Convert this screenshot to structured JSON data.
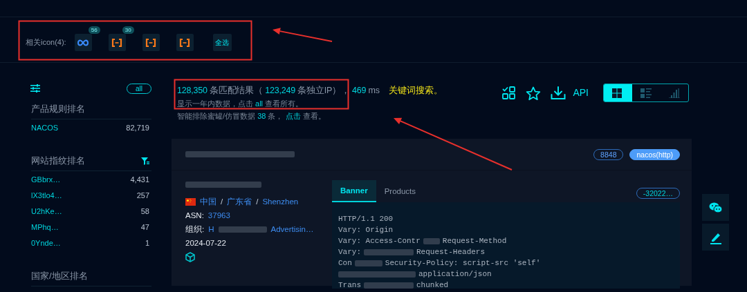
{
  "icon_filter": {
    "label": "相关icon(4):",
    "icons": [
      {
        "kind": "infinity",
        "badge": "56"
      },
      {
        "kind": "bracket",
        "badge": "30"
      },
      {
        "kind": "bracket"
      },
      {
        "kind": "bracket"
      },
      {
        "kind": "select_all",
        "text": "全选"
      }
    ]
  },
  "sidebar": {
    "all_button": "all",
    "sections": [
      {
        "title": "产品规则排名",
        "filter": false,
        "items": [
          {
            "name": "NACOS",
            "count": "82,719"
          }
        ]
      },
      {
        "title": "网站指纹排名",
        "filter": true,
        "items": [
          {
            "name": "GBbrx…",
            "count": "4,431"
          },
          {
            "name": "lX3tlo4…",
            "count": "257"
          },
          {
            "name": "U2hKe…",
            "count": "58"
          },
          {
            "name": "MPhq…",
            "count": "47"
          },
          {
            "name": "0Ynde…",
            "count": "1"
          }
        ]
      },
      {
        "title": "国家/地区排名",
        "filter": false
      }
    ]
  },
  "summary": {
    "total": "128,350",
    "total_label": "条匹配结果（",
    "ips": "123,249",
    "ips_label": "条独立IP），",
    "time": "469",
    "time_unit": "ms",
    "note_before": "显示一年内数据，点击",
    "note_link": "all",
    "note_after": "查看所有。",
    "honeypot_before": "智能排除蜜罐/仿冒数据",
    "honeypot_count": "38",
    "honeypot_mid": "条，",
    "honeypot_link": "点击",
    "honeypot_after": "查看。"
  },
  "toolbar": {
    "api": "API",
    "views": [
      {
        "kind": "grid",
        "selected": true
      },
      {
        "kind": "list",
        "selected": false
      },
      {
        "kind": "chart",
        "selected": false
      }
    ]
  },
  "result": {
    "tags": [
      {
        "text": "8848",
        "filled": false
      },
      {
        "text": "nacos(http)",
        "filled": true
      }
    ],
    "location": [
      {
        "kind": "link",
        "text": "中国"
      },
      {
        "kind": "separator",
        "text": "/"
      },
      {
        "kind": "link",
        "text": "广东省"
      },
      {
        "kind": "separator",
        "text": "/"
      },
      {
        "kind": "link",
        "text": "Shenzhen"
      }
    ],
    "asn_label": "ASN:",
    "asn": "37963",
    "org_label": "组织:",
    "org_start": "H",
    "org_end": "Advertisin…",
    "date": "2024-07-22",
    "tabs": [
      {
        "label": "Banner",
        "selected": true
      },
      {
        "label": "Products",
        "selected": false
      }
    ],
    "cert_tag": "-32022…",
    "banner": [
      [
        {
          "t": "HTTP/1.1 200"
        }
      ],
      [
        {
          "t": "Vary: Origin"
        }
      ],
      [
        {
          "t": "Vary: Access-Contr"
        },
        {
          "kind": "redacted"
        },
        {
          "t": "Request-Method"
        }
      ],
      [
        {
          "t": "Vary:"
        },
        {
          "kind": "redacted"
        },
        {
          "t": "Request-Headers"
        }
      ],
      [
        {
          "t": "Con"
        },
        {
          "kind": "redacted"
        },
        {
          "t": "Security-Policy: script-src 'self'"
        }
      ],
      [
        {
          "kind": "redacted"
        },
        {
          "t": "application/json"
        }
      ],
      [
        {
          "t": "Trans"
        },
        {
          "kind": "redacted"
        },
        {
          "t": "chunked"
        }
      ]
    ]
  },
  "annotations": [
    {
      "kind": "box"
    },
    {
      "kind": "box"
    },
    {
      "kind": "arrow"
    },
    {
      "kind": "arrow"
    }
  ],
  "annotation_text": "关键词搜索。"
}
